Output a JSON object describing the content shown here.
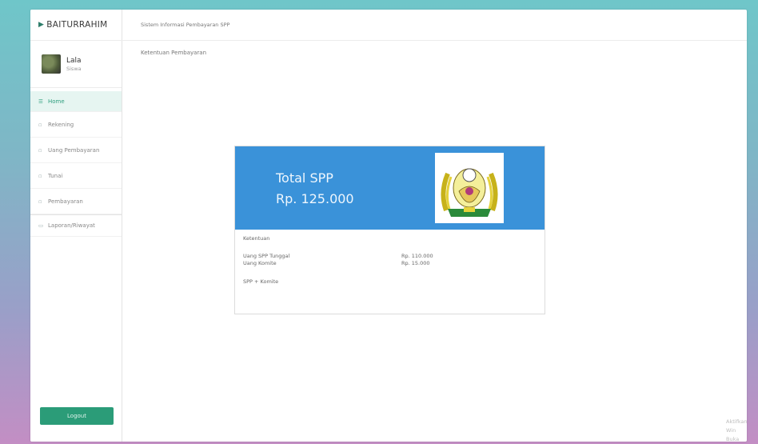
{
  "brand": "BAITURRAHIM",
  "user": {
    "name": "Lala",
    "role": "Siswa"
  },
  "nav": [
    {
      "label": "Home",
      "icon": "home-icon",
      "active": true
    },
    {
      "label": "Rekening",
      "icon": "wallet-icon"
    },
    {
      "label": "Uang Pembayaran",
      "icon": "money-icon"
    },
    {
      "label": "Tunai",
      "icon": "cash-icon"
    },
    {
      "label": "Pembayaran",
      "icon": "payment-icon"
    },
    {
      "label": "Laporan/Riwayat",
      "icon": "report-icon"
    }
  ],
  "logout_label": "Logout",
  "topbar_title": "Sistem Informasi Pembayaran SPP",
  "section_title": "Ketentuan Pembayaran",
  "card": {
    "title": "Total SPP",
    "amount": "Rp. 125.000",
    "subtitle": "Ketentuan",
    "rows": [
      {
        "label": "Uang SPP Tunggal",
        "value": "Rp. 110.000"
      },
      {
        "label": "Uang Komite",
        "value": "Rp. 15.000"
      }
    ],
    "formula": "SPP + Komite"
  },
  "watermark": [
    "Aktifkan Win",
    "Buka Pengaturan"
  ],
  "colors": {
    "accent": "#3a92d9",
    "brand_green": "#2b9c78"
  }
}
